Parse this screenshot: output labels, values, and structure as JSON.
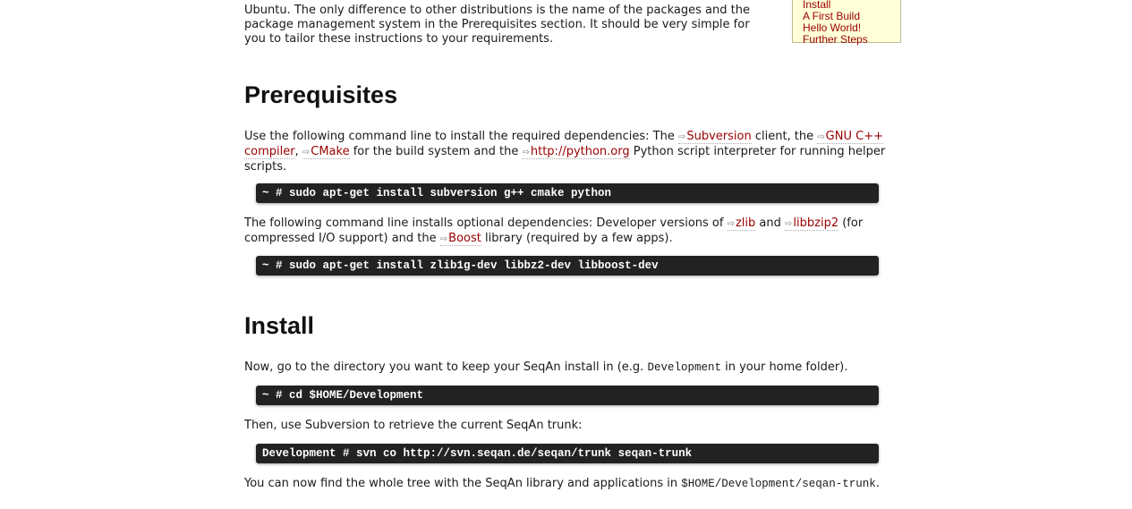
{
  "toc": {
    "items": [
      "Install",
      "A First Build",
      "Hello World!",
      "Further Steps"
    ]
  },
  "intro": {
    "text": "Ubuntu. The only difference to other distributions is the name of the packages and the package management system in the Prerequisites section. It should be very simple for you to tailor these instructions to your requirements."
  },
  "prerequisites": {
    "heading": "Prerequisites",
    "p1": {
      "t1": "Use the following command line to install the required dependencies: The ",
      "link1": "Subversion",
      "t2": " client, the ",
      "link2": "GNU C++ compiler",
      "t3": ", ",
      "link3": "CMake",
      "t4": " for the build system and the ",
      "link4": "http://python.org",
      "t5": " Python script interpreter for running helper scripts."
    },
    "cmd1": "~ # sudo apt-get install subversion g++ cmake python",
    "p2": {
      "t1": "The following command line installs optional dependencies: Developer versions of ",
      "link1": "zlib",
      "t2": " and ",
      "link2": "libbzip2",
      "t3": " (for compressed I/O support) and the ",
      "link3": "Boost",
      "t4": " library (required by a few apps)."
    },
    "cmd2": "~ # sudo apt-get install zlib1g-dev libbz2-dev libboost-dev"
  },
  "install": {
    "heading": "Install",
    "p1": {
      "t1": "Now, go to the directory you want to keep your SeqAn install in (e.g. ",
      "code": "Development",
      "t2": " in your home folder)."
    },
    "cmd1": "~ # cd $HOME/Development",
    "p2": "Then, use Subversion to retrieve the current SeqAn trunk:",
    "cmd2": "Development # svn co http://svn.seqan.de/seqan/trunk seqan-trunk",
    "p3": {
      "t1": "You can now find the whole tree with the SeqAn library and applications in ",
      "code": "$HOME/Development/seqan-trunk",
      "t2": "."
    }
  },
  "colors": {
    "link": "#990000",
    "command_bg": "#222222",
    "toc_bg": "#ffffd8"
  },
  "icons": {
    "external_link": "external-link-icon"
  }
}
